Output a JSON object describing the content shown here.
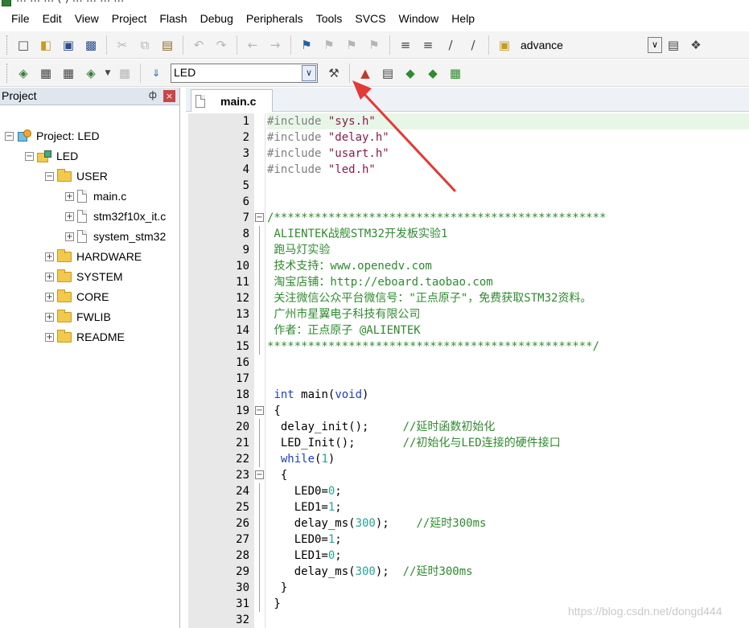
{
  "title_clip": "… … … ( ) … … … …",
  "menu": [
    "File",
    "Edit",
    "View",
    "Project",
    "Flash",
    "Debug",
    "Peripherals",
    "Tools",
    "SVCS",
    "Window",
    "Help"
  ],
  "toolbar1": {
    "icons": [
      "new-file-icon",
      "open-folder-icon",
      "save-icon",
      "save-all-icon",
      "cut-icon",
      "copy-icon",
      "paste-icon",
      "undo-icon",
      "redo-icon",
      "back-icon",
      "forward-icon",
      "bookmark-icon",
      "bookmark-prev-icon",
      "bookmark-next-icon",
      "bookmark-clear-icon",
      "indent-icon",
      "unindent-icon",
      "comment-icon",
      "uncomment-icon",
      "find-in-files-icon"
    ],
    "find_value": "advance"
  },
  "toolbar2": {
    "target_value": "LED"
  },
  "project": {
    "title": "Project",
    "pin": "ф",
    "close": "×",
    "root": "Project: LED",
    "target": "LED",
    "groups": [
      {
        "name": "USER",
        "files": [
          "main.c",
          "stm32f10x_it.c",
          "system_stm32"
        ]
      },
      {
        "name": "HARDWARE"
      },
      {
        "name": "SYSTEM"
      },
      {
        "name": "CORE"
      },
      {
        "name": "FWLIB"
      },
      {
        "name": "README"
      }
    ]
  },
  "editor": {
    "tab": "main.c",
    "lines": [
      {
        "n": "1",
        "segs": [
          {
            "t": "#include ",
            "c": "pp"
          },
          {
            "t": "\"sys.h\"",
            "c": "str"
          }
        ]
      },
      {
        "n": "2",
        "segs": [
          {
            "t": "#include ",
            "c": "pp"
          },
          {
            "t": "\"delay.h\"",
            "c": "str"
          }
        ]
      },
      {
        "n": "3",
        "segs": [
          {
            "t": "#include ",
            "c": "pp"
          },
          {
            "t": "\"usart.h\"",
            "c": "str"
          }
        ]
      },
      {
        "n": "4",
        "segs": [
          {
            "t": "#include ",
            "c": "pp"
          },
          {
            "t": "\"led.h\"",
            "c": "str"
          }
        ]
      },
      {
        "n": "5",
        "segs": []
      },
      {
        "n": "6",
        "segs": []
      },
      {
        "n": "7",
        "segs": [
          {
            "t": "/*************************************************",
            "c": "cm"
          }
        ]
      },
      {
        "n": "8",
        "segs": [
          {
            "t": " ALIENTEK战舰STM32开发板实验1",
            "c": "cm"
          }
        ]
      },
      {
        "n": "9",
        "segs": [
          {
            "t": " 跑马灯实验",
            "c": "cm"
          }
        ]
      },
      {
        "n": "10",
        "segs": [
          {
            "t": " 技术支持：www.openedv.com",
            "c": "cm"
          }
        ]
      },
      {
        "n": "11",
        "segs": [
          {
            "t": " 淘宝店铺：http://eboard.taobao.com",
            "c": "cm"
          }
        ]
      },
      {
        "n": "12",
        "segs": [
          {
            "t": " 关注微信公众平台微信号：\"正点原子\"，免费获取STM32资料。",
            "c": "cm"
          }
        ]
      },
      {
        "n": "13",
        "segs": [
          {
            "t": " 广州市星翼电子科技有限公司",
            "c": "cm"
          }
        ]
      },
      {
        "n": "14",
        "segs": [
          {
            "t": " 作者：正点原子 @ALIENTEK",
            "c": "cm"
          }
        ]
      },
      {
        "n": "15",
        "segs": [
          {
            "t": "************************************************/",
            "c": "cm"
          }
        ]
      },
      {
        "n": "16",
        "segs": []
      },
      {
        "n": "17",
        "segs": []
      },
      {
        "n": "18",
        "segs": [
          {
            "t": " ",
            "c": ""
          },
          {
            "t": "int",
            "c": "kw"
          },
          {
            "t": " main(",
            "c": ""
          },
          {
            "t": "void",
            "c": "kw"
          },
          {
            "t": ")",
            "c": ""
          }
        ]
      },
      {
        "n": "19",
        "segs": [
          {
            "t": " {",
            "c": ""
          }
        ]
      },
      {
        "n": "20",
        "segs": [
          {
            "t": "  delay_init();     ",
            "c": ""
          },
          {
            "t": "//延时函数初始化",
            "c": "cm"
          }
        ]
      },
      {
        "n": "21",
        "segs": [
          {
            "t": "  LED_Init();       ",
            "c": ""
          },
          {
            "t": "//初始化与LED连接的硬件接口",
            "c": "cm"
          }
        ]
      },
      {
        "n": "22",
        "segs": [
          {
            "t": "  ",
            "c": ""
          },
          {
            "t": "while",
            "c": "kw"
          },
          {
            "t": "(",
            "c": ""
          },
          {
            "t": "1",
            "c": "num"
          },
          {
            "t": ")",
            "c": ""
          }
        ]
      },
      {
        "n": "23",
        "segs": [
          {
            "t": "  {",
            "c": ""
          }
        ]
      },
      {
        "n": "24",
        "segs": [
          {
            "t": "    LED0=",
            "c": ""
          },
          {
            "t": "0",
            "c": "num"
          },
          {
            "t": ";",
            "c": ""
          }
        ]
      },
      {
        "n": "25",
        "segs": [
          {
            "t": "    LED1=",
            "c": ""
          },
          {
            "t": "1",
            "c": "num"
          },
          {
            "t": ";",
            "c": ""
          }
        ]
      },
      {
        "n": "26",
        "segs": [
          {
            "t": "    delay_ms(",
            "c": ""
          },
          {
            "t": "300",
            "c": "num"
          },
          {
            "t": ");    ",
            "c": ""
          },
          {
            "t": "//延时300ms",
            "c": "cm"
          }
        ]
      },
      {
        "n": "27",
        "segs": [
          {
            "t": "    LED0=",
            "c": ""
          },
          {
            "t": "1",
            "c": "num"
          },
          {
            "t": ";",
            "c": ""
          }
        ]
      },
      {
        "n": "28",
        "segs": [
          {
            "t": "    LED1=",
            "c": ""
          },
          {
            "t": "0",
            "c": "num"
          },
          {
            "t": ";",
            "c": ""
          }
        ]
      },
      {
        "n": "29",
        "segs": [
          {
            "t": "    delay_ms(",
            "c": ""
          },
          {
            "t": "300",
            "c": "num"
          },
          {
            "t": ");  ",
            "c": ""
          },
          {
            "t": "//延时300ms",
            "c": "cm"
          }
        ]
      },
      {
        "n": "30",
        "segs": [
          {
            "t": "  }",
            "c": ""
          }
        ]
      },
      {
        "n": "31",
        "segs": [
          {
            "t": " }",
            "c": ""
          }
        ]
      },
      {
        "n": "32",
        "segs": []
      }
    ]
  },
  "watermark": "https://blog.csdn.net/dongd444",
  "colors": {
    "annotation_arrow": "#e53935",
    "current_line": "#e8f6e8",
    "comment": "#2e8b2e",
    "keyword": "#1f3fbf",
    "string": "#8b1a4b"
  }
}
